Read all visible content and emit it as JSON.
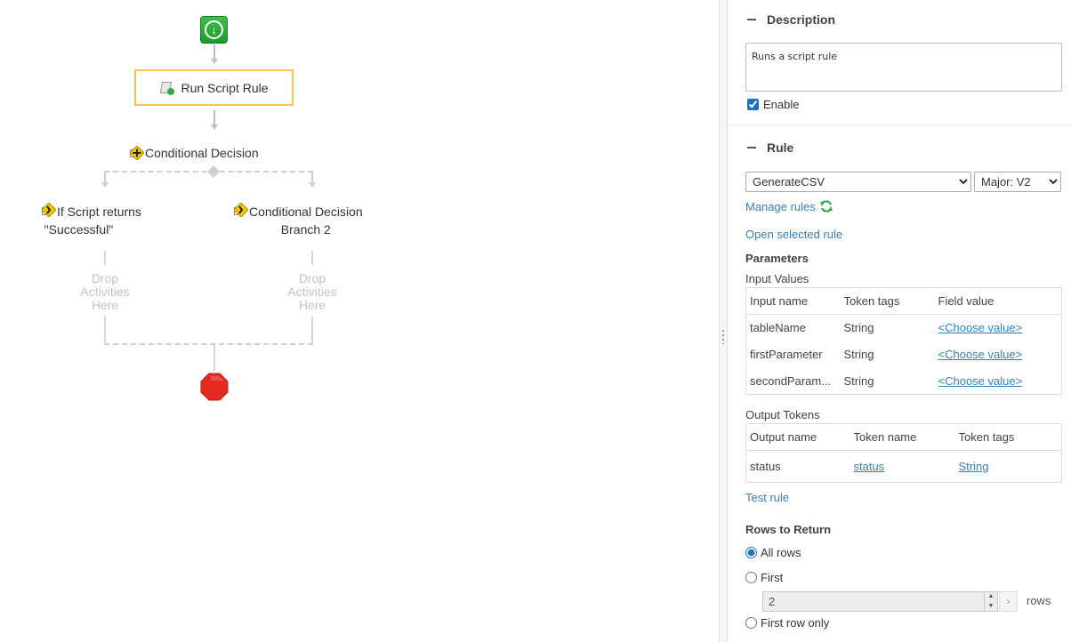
{
  "canvas": {
    "activity_label": "Run Script Rule",
    "decision_label": "Conditional Decision",
    "branches": [
      {
        "label_line1": "If Script returns",
        "label_line2": "\"Successful\""
      },
      {
        "label_line1": "Conditional Decision",
        "label_line2": "Branch 2"
      }
    ],
    "drop_text": [
      "Drop",
      "Activities",
      "Here"
    ]
  },
  "panel": {
    "description": {
      "title": "Description",
      "text": "Runs a script rule",
      "enable_label": "Enable",
      "enabled": true
    },
    "rule": {
      "title": "Rule",
      "selected_rule": "GenerateCSV",
      "selected_version": "Major: V2",
      "manage_rules": "Manage rules",
      "open_selected": "Open selected rule",
      "parameters_label": "Parameters",
      "input_values_label": "Input Values",
      "input_headers": [
        "Input name",
        "Token tags",
        "Field value"
      ],
      "inputs": [
        {
          "name": "tableName",
          "tags": "String",
          "value": "<Choose value>"
        },
        {
          "name": "firstParameter",
          "tags": "String",
          "value": "<Choose value>"
        },
        {
          "name": "secondParam...",
          "tags": "String",
          "value": "<Choose value>"
        }
      ],
      "output_tokens_label": "Output Tokens",
      "output_headers": [
        "Output name",
        "Token name",
        "Token tags"
      ],
      "outputs": [
        {
          "name": "status",
          "token": "status",
          "tags": "String"
        }
      ],
      "test_rule": "Test rule",
      "rows_to_return_label": "Rows to Return",
      "rows_options": [
        "All rows",
        "First",
        "First row only"
      ],
      "rows_selected": "All rows",
      "first_count": "2",
      "rows_unit": "rows"
    }
  }
}
